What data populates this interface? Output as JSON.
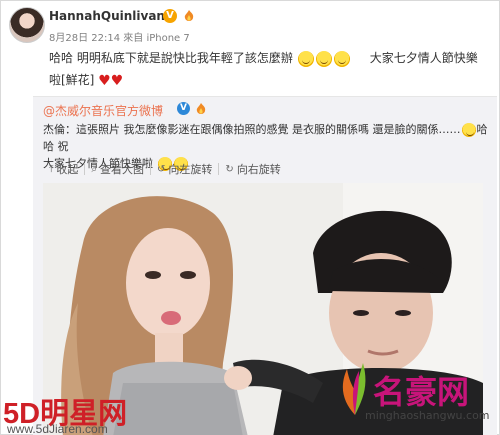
{
  "post": {
    "username": "HannahQuinlivan",
    "verified_badge": "V",
    "timestamp": "8月28日 22:14",
    "source": "來自 iPhone 7",
    "text_part1": "哈哈 明明私底下就是說快比我年輕了該怎麼辦",
    "text_part2": "大家七夕情人節快樂",
    "text_part3": "啦[鮮花]"
  },
  "repost": {
    "author": "@杰威尔音乐官方微博",
    "verified_badge": "V",
    "body_line1": "杰倫：這張照片 我怎麼像影迷在跟偶像拍照的感覺 是衣服的關係嗎 還是臉的關係……",
    "body_line1_tail": "哈哈 祝",
    "body_line2": "大家七夕情人節快樂啦",
    "toolbar": {
      "collect": "收起",
      "view_large": "查看大图",
      "rotate_left": "向左旋转",
      "rotate_right": "向右旋转"
    }
  },
  "watermarks": {
    "left_logo": "5D明星网",
    "left_url": "www.5dJiaren.com",
    "right_brand": "名豪网",
    "right_domain": "minghaoshangwu.com"
  },
  "colors": {
    "link_orange": "#eb7350",
    "repost_bg": "#f2f2f5",
    "verified_yellow": "#f7a400",
    "verified_blue": "#2d88d8",
    "logo_red": "#cf2027",
    "brand_magenta": "#c8147a"
  }
}
